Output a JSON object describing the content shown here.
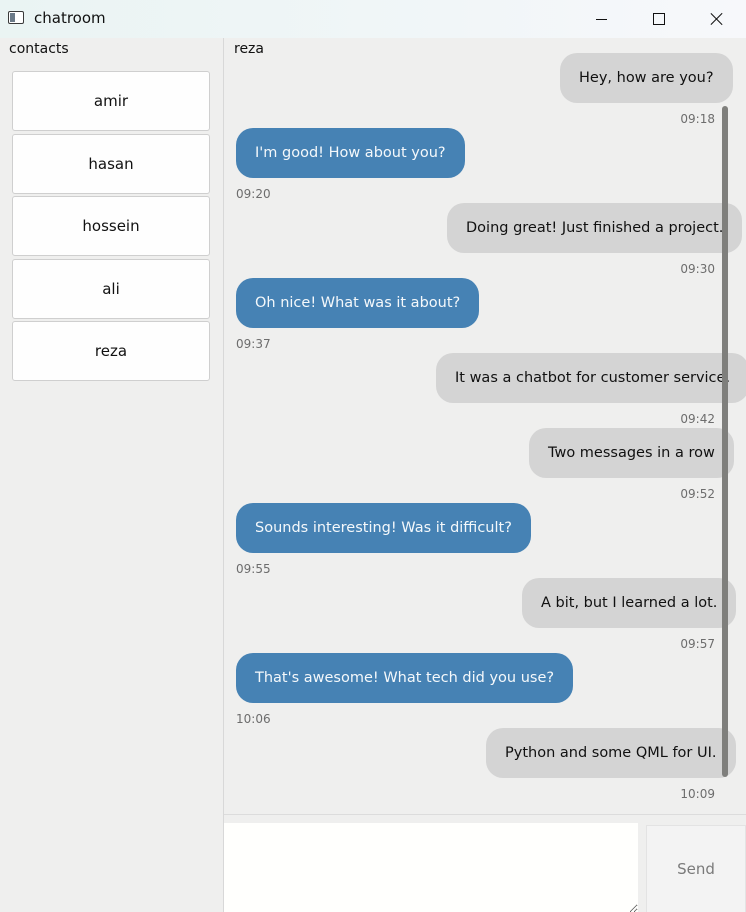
{
  "window": {
    "title": "chatroom"
  },
  "contacts": {
    "heading": "contacts",
    "items": [
      {
        "name": "amir"
      },
      {
        "name": "hasan"
      },
      {
        "name": "hossein"
      },
      {
        "name": "ali"
      },
      {
        "name": "reza"
      }
    ]
  },
  "chat": {
    "contact": "reza",
    "messages": [
      {
        "direction": "out",
        "text": "Hey, how are you?",
        "time": "09:18"
      },
      {
        "direction": "in",
        "text": "I'm good! How about you?",
        "time": "09:20"
      },
      {
        "direction": "out",
        "text": "Doing great! Just finished a project.",
        "time": "09:30"
      },
      {
        "direction": "in",
        "text": "Oh nice! What was it about?",
        "time": "09:37"
      },
      {
        "direction": "out",
        "text": "It was a chatbot for customer service.",
        "time": "09:42"
      },
      {
        "direction": "out",
        "text": "Two messages in a row",
        "time": "09:52"
      },
      {
        "direction": "in",
        "text": "Sounds interesting! Was it difficult?",
        "time": "09:55"
      },
      {
        "direction": "out",
        "text": "A bit, but I learned a lot.",
        "time": "09:57"
      },
      {
        "direction": "in",
        "text": "That's awesome! What tech did you use?",
        "time": "10:06"
      },
      {
        "direction": "out",
        "text": "Python and some QML for UI.",
        "time": "10:09"
      }
    ]
  },
  "composer": {
    "input_value": "",
    "send_label": "Send"
  },
  "colors": {
    "outgoing_bubble": "#d4d4d4",
    "incoming_bubble": "#4682b4"
  }
}
